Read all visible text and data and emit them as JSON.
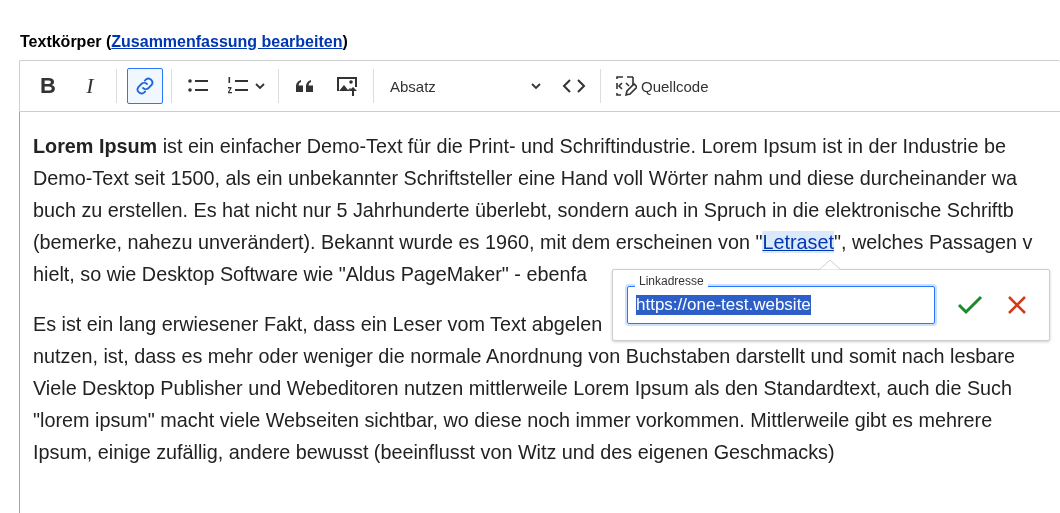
{
  "field_label": {
    "text": "Textkörper (",
    "link": "Zusammenfassung bearbeiten",
    "after": ")"
  },
  "toolbar": [
    {
      "kind": "bold",
      "label": "B",
      "on": false
    },
    {
      "kind": "italic",
      "label": "I",
      "on": false
    },
    {
      "kind": "separator"
    },
    {
      "kind": "link",
      "on": true
    },
    {
      "kind": "separator"
    },
    {
      "kind": "bulleted_list",
      "on": false
    },
    {
      "kind": "numbered_list",
      "on": false
    },
    {
      "kind": "separator"
    },
    {
      "kind": "blockquote",
      "on": false
    },
    {
      "kind": "image",
      "on": false
    },
    {
      "kind": "separator"
    },
    {
      "kind": "heading",
      "label": "Absatz"
    },
    {
      "kind": "code",
      "on": false
    },
    {
      "kind": "separator"
    },
    {
      "kind": "source",
      "label": "Quellcode",
      "on": false
    }
  ],
  "paragraphs": [
    {
      "lines": [
        {
          "text": "**Lorem Ipsum** ist ein einfacher Demo-Text für die Print- und Schriftindustrie. Lorem Ipsum ist in der Industrie be"
        },
        {
          "text": "Demo-Text seit 1500, als ein unbekannter Schriftsteller eine Hand voll Wörter nahm und diese durcheinander wa"
        },
        {
          "text": "buch zu erstellen. Es hat nicht nur 5 Jahrhunderte überlebt, sondern auch in Spruch in die elektronische Schriftb"
        },
        {
          "text": "(bemerke, nahezu unverändert). Bekannt wurde es 1960, mit dem erscheinen von \"",
          "link": "Letraset",
          "after": "\", welches Passagen v"
        },
        {
          "text": "hielt, so wie Desktop Software wie \"Aldus PageMaker\" - ebenfa"
        }
      ]
    },
    {
      "lines": [
        {
          "text": "Es ist ein lang erwiesener Fakt, dass ein Leser vom Text abgelen"
        },
        {
          "text": "nutzen, ist, dass es mehr oder weniger die normale Anordnung von Buchstaben darstellt und somit nach lesbare"
        },
        {
          "text": "Viele Desktop Publisher und Webeditoren nutzen mittlerweile Lorem Ipsum als den Standardtext, auch die Such"
        },
        {
          "text": "\"lorem ipsum\" macht viele Webseiten sichtbar, wo diese noch immer vorkommen. Mittlerweile gibt es mehrere"
        },
        {
          "text": "Ipsum, einige zufällig, andere bewusst (beeinflusst von Witz und des eigenen Geschmacks)"
        }
      ]
    }
  ],
  "link_balloon": {
    "label": "Linkadresse",
    "value": "https://one-test.website",
    "selected_text": true
  }
}
